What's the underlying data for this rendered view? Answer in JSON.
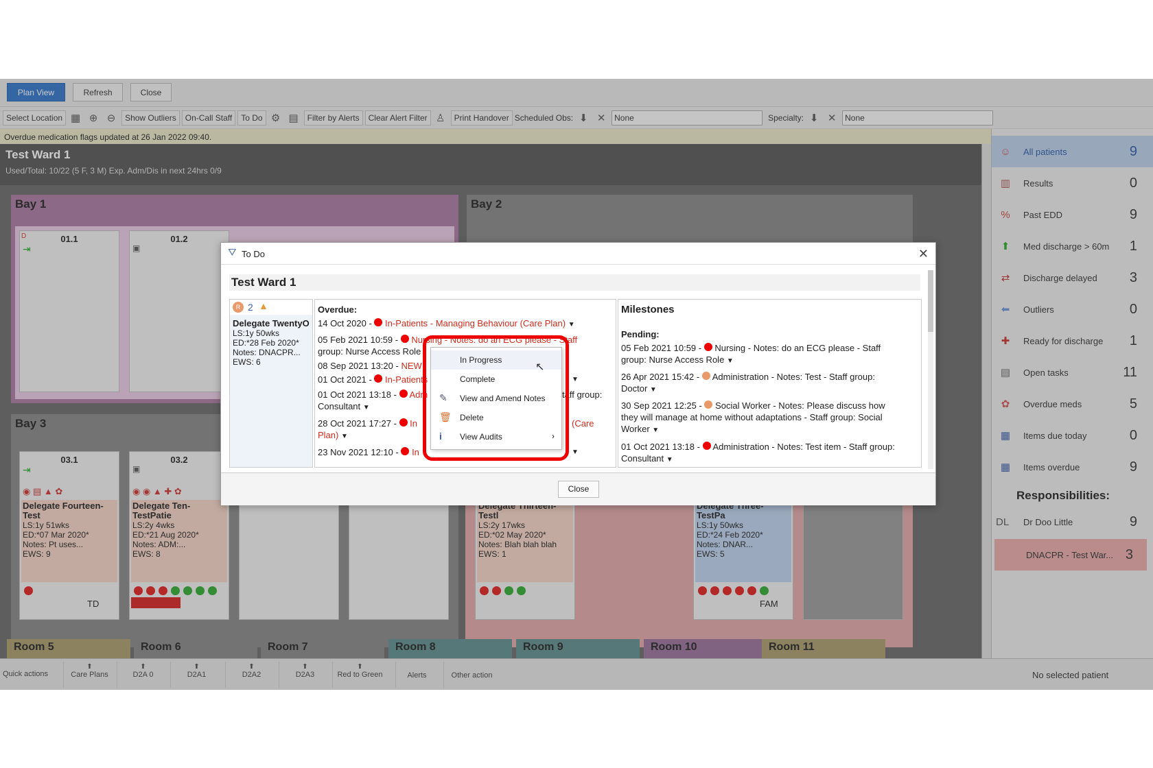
{
  "topbar": {
    "plan_view": "Plan View",
    "refresh": "Refresh",
    "close": "Close"
  },
  "toolbar": {
    "select_location": "Select Location",
    "show_outliers": "Show Outliers",
    "on_call_staff": "On-Call Staff",
    "to_do": "To Do",
    "filter_alerts": "Filter by Alerts",
    "clear_filter": "Clear Alert Filter",
    "print_handover": "Print Handover",
    "scheduled_obs": "Scheduled Obs:",
    "scheduled_value": "None",
    "specialty": "Specialty:",
    "specialty_value": "None"
  },
  "message": "Overdue medication flags updated at 26 Jan 2022 09:40.",
  "ward": {
    "title": "Test Ward 1",
    "stats": "Used/Total: 10/22 (5 F, 3 M) Exp. Adm/Dis in next 24hrs 0/9"
  },
  "bays": {
    "bay1": "Bay 1",
    "bay2": "Bay 2",
    "bay3": "Bay 3"
  },
  "beds": {
    "b011": "01.1",
    "b012": "01.2",
    "b031": "03.1",
    "b032": "03.2",
    "d_label": "D"
  },
  "patients": [
    {
      "name": "Delegate Fourteen-Test",
      "ls": "LS:1y 51wks",
      "ed": "ED:*07 Mar 2020*",
      "notes": "Notes: Pt uses...",
      "ews": "EWS: 9",
      "tag": "TD"
    },
    {
      "name": "Delegate Ten-TestPatie",
      "ls": "LS:2y 4wks",
      "ed": "ED:*21 Aug 2020*",
      "notes": "Notes: ADM:...",
      "ews": "EWS: 8"
    },
    {
      "name": "Delegate Thirteen-Testl",
      "ls": "LS:2y 17wks",
      "ed": "ED:*02 May 2020*",
      "notes": "Notes: Blah blah blah",
      "ews": "EWS: 1"
    },
    {
      "name": "Delegate Three-TestPa",
      "ls": "LS:1y 50wks",
      "ed": "ED:*24 Feb 2020*",
      "notes": "Notes: DNAR...",
      "ews": "EWS: 5",
      "tag": "FAM"
    }
  ],
  "rooms": [
    "Room 5",
    "Room 6",
    "Room 7",
    "Room 8",
    "Room 9",
    "Room 10",
    "Room 11"
  ],
  "quick_actions": {
    "label": "Quick actions",
    "items": [
      "Care Plans",
      "D2A 0",
      "D2A1",
      "D2A2",
      "D2A3",
      "Red to Green"
    ],
    "alerts": "Alerts",
    "other": "Other action"
  },
  "right_panel": {
    "items": [
      {
        "label": "All patients",
        "count": "9",
        "icon": "patients-icon"
      },
      {
        "label": "Results",
        "count": "0",
        "icon": "results-icon"
      },
      {
        "label": "Past EDD",
        "count": "9",
        "icon": "past-edd-icon"
      },
      {
        "label": "Med discharge > 60m",
        "count": "1",
        "icon": "med-discharge-icon"
      },
      {
        "label": "Discharge delayed",
        "count": "3",
        "icon": "discharge-delayed-icon"
      },
      {
        "label": "Outliers",
        "count": "0",
        "icon": "outliers-icon"
      },
      {
        "label": "Ready for discharge",
        "count": "1",
        "icon": "ready-discharge-icon"
      },
      {
        "label": "Open tasks",
        "count": "11",
        "icon": "open-tasks-icon"
      },
      {
        "label": "Overdue meds",
        "count": "5",
        "icon": "overdue-meds-icon"
      },
      {
        "label": "Items due today",
        "count": "0",
        "icon": "items-due-icon"
      },
      {
        "label": "Items overdue",
        "count": "9",
        "icon": "items-overdue-icon"
      }
    ],
    "responsibilities": "Responsibilities:",
    "resp_items": [
      {
        "prefix": "DL",
        "label": "Dr Doo Little",
        "count": "9"
      },
      {
        "label": "DNACPR - Test War...",
        "count": "3"
      }
    ],
    "no_selected": "No selected patient"
  },
  "dialog": {
    "title": "To Do",
    "ward": "Test Ward 1",
    "patient": {
      "badge": "R",
      "count": "2",
      "name": "Delegate TwentyO",
      "ls": "LS:1y 50wks",
      "ed": "ED:*28 Feb 2020*",
      "notes": "Notes: DNACPR...",
      "ews": "EWS: 6"
    },
    "overdue_label": "Overdue:",
    "overdue": [
      {
        "date": "14 Oct 2020 -",
        "text": "In-Patients - Managing Behaviour (Care Plan)"
      },
      {
        "date": "05 Feb 2021 10:59 -",
        "text": "Nursing - Notes: do an ECG please - Staff",
        "text2": "group: Nurse Access Role"
      },
      {
        "date": "08 Sep 2021 13:20 -",
        "text": "NEW"
      },
      {
        "date": "01 Oct 2021 -",
        "text": "In-Patients"
      },
      {
        "date": "01 Oct 2021 13:18 -",
        "text": "Adm",
        "text_right": "taff group:",
        "text2": "Consultant"
      },
      {
        "date": "28 Oct 2021 17:27 -",
        "text": "In",
        "text_right": "(Care",
        "text2": "Plan)"
      },
      {
        "date": "23 Nov 2021 12:10 -",
        "text": "In"
      }
    ],
    "milestones_label": "Milestones",
    "pending_label": "Pending:",
    "milestones": [
      {
        "date": "05 Feb 2021 10:59 -",
        "text": "Nursing - Notes: do an ECG please - Staff",
        "text2": "group: Nurse Access Role"
      },
      {
        "date": "26 Apr 2021 15:42 -",
        "text": "Administration - Notes: Test - Staff group:",
        "text2": "Doctor"
      },
      {
        "date": "30 Sep 2021 12:25 -",
        "text": "Social Worker - Notes: Please discuss how",
        "text2": "they will manage at home without adaptations - Staff group: Social",
        "text3": "Worker"
      },
      {
        "date": "01 Oct 2021 13:18 -",
        "text": "Administration - Notes: Test item - Staff group:",
        "text2": "Consultant"
      }
    ],
    "close": "Close"
  },
  "context_menu": {
    "items": [
      "In Progress",
      "Complete",
      "View and Amend Notes",
      "Delete",
      "View Audits"
    ]
  }
}
